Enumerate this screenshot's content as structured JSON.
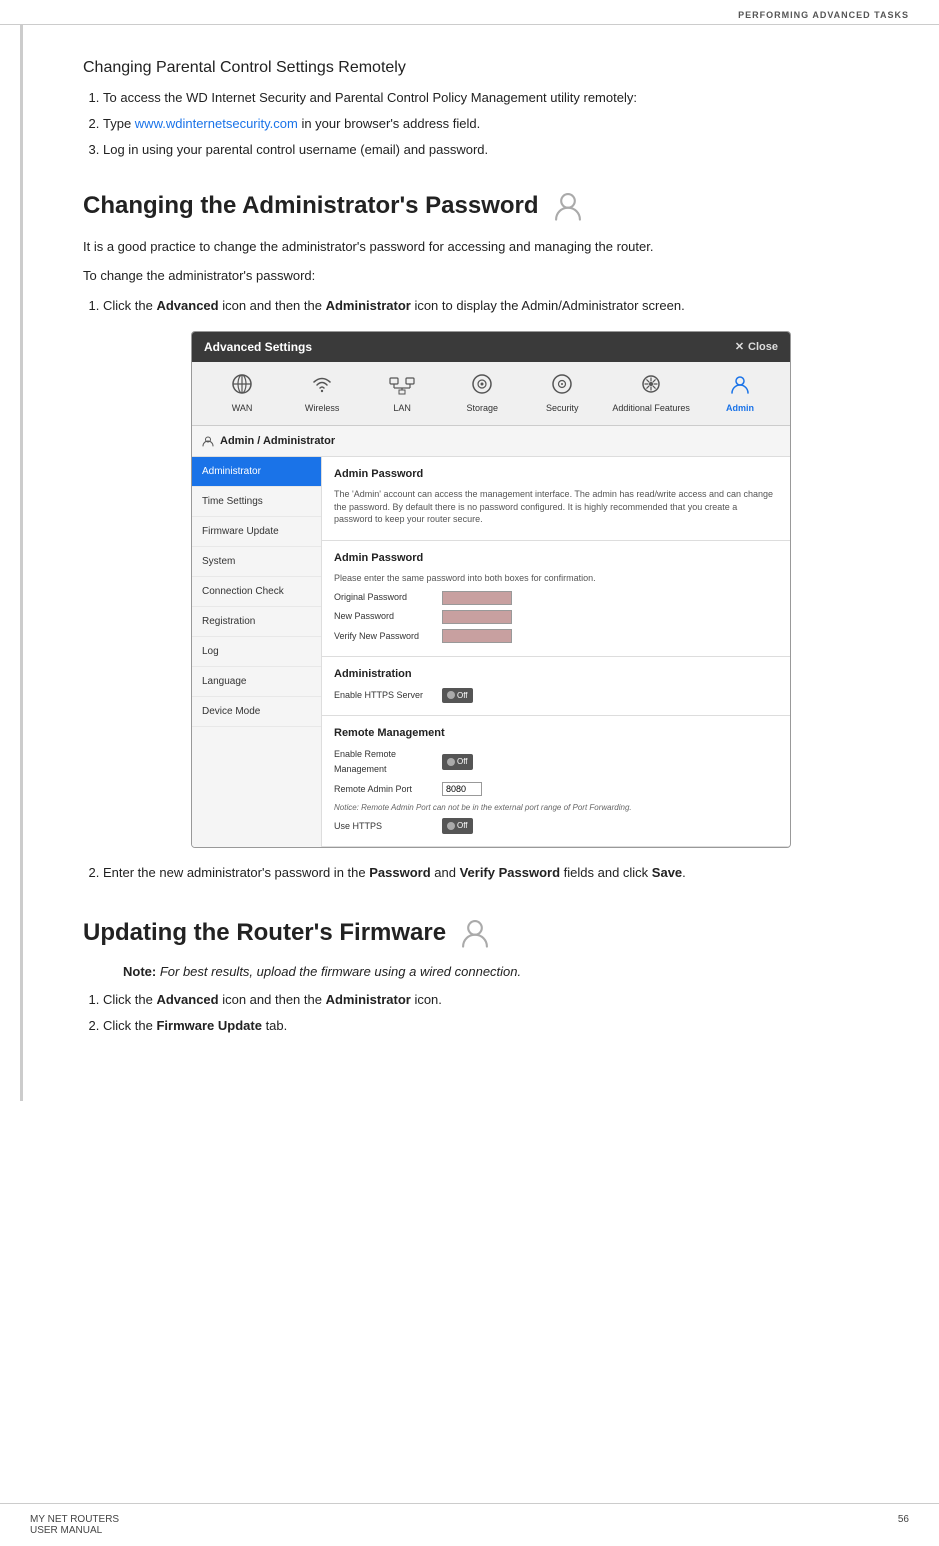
{
  "header": {
    "title": "PERFORMING ADVANCED TASKS"
  },
  "section1": {
    "title": "Changing Parental Control Settings Remotely",
    "steps": [
      "To access the WD Internet Security and Parental Control Policy Management utility remotely:",
      "Type www.wdinternetsecurity.com in your browser's address field.",
      "Log in using your parental control username (email) and password."
    ],
    "link_text": "www.wdinternetsecurity.com"
  },
  "section2": {
    "title": "Changing the Administrator's Password",
    "intro1": "It is a good practice to change the administrator's password for accessing and managing the router.",
    "intro2": "To change the administrator's password:",
    "steps": [
      {
        "text_before": "Click the ",
        "bold1": "Advanced",
        "text_mid": " icon and then the ",
        "bold2": "Administrator",
        "text_after": " icon to display the Admin/Administrator screen."
      },
      {
        "text_before": "Enter the new administrator's password in the ",
        "bold1": "Password",
        "text_mid": " and ",
        "bold2": "Verify Password",
        "text_after": " fields and click ",
        "bold3": "Save",
        "text_end": "."
      }
    ],
    "panel": {
      "titlebar": "Advanced Settings",
      "close_label": "Close",
      "nav_items": [
        {
          "label": "WAN",
          "icon": "globe"
        },
        {
          "label": "Wireless",
          "icon": "wifi"
        },
        {
          "label": "LAN",
          "icon": "lan"
        },
        {
          "label": "Storage",
          "icon": "storage"
        },
        {
          "label": "Security",
          "icon": "security"
        },
        {
          "label": "Additional Features",
          "icon": "features"
        },
        {
          "label": "Admin",
          "icon": "admin",
          "active": true
        }
      ],
      "section_header": "Admin / Administrator",
      "sidebar_items": [
        {
          "label": "Administrator",
          "active": true
        },
        {
          "label": "Time Settings"
        },
        {
          "label": "Firmware Update"
        },
        {
          "label": "System"
        },
        {
          "label": "Connection Check"
        },
        {
          "label": "Registration"
        },
        {
          "label": "Log"
        },
        {
          "label": "Language"
        },
        {
          "label": "Device Mode"
        }
      ],
      "form_section1_title": "Admin Password",
      "form_section1_desc": "The 'Admin' account can access the management interface. The admin has read/write access and can change the password. By default there is no password configured. It is highly recommended that you create a password to keep your router secure.",
      "form_section2_title": "Admin Password",
      "form_section2_desc": "Please enter the same password into both boxes for confirmation.",
      "form_fields": [
        {
          "label": "Original Password"
        },
        {
          "label": "New Password"
        },
        {
          "label": "Verify New Password"
        }
      ],
      "admin_section_title": "Administration",
      "https_label": "Enable HTTPS Server",
      "https_value": "Off",
      "remote_section_title": "Remote Management",
      "remote_mgmt_label": "Enable Remote Management",
      "remote_mgmt_value": "Off",
      "remote_port_label": "Remote Admin Port",
      "remote_port_value": "8080",
      "notice": "Notice: Remote Admin Port can not be in the external port range of Port Forwarding.",
      "use_https_label": "Use HTTPS",
      "use_https_value": "Off"
    }
  },
  "section3": {
    "title": "Updating the Router's Firmware",
    "note_label": "Note:",
    "note_text": "For best results, upload the firmware using a wired connection.",
    "steps": [
      {
        "text_before": "Click the ",
        "bold1": "Advanced",
        "text_mid": " icon and then the ",
        "bold2": "Administrator",
        "text_after": " icon."
      },
      {
        "text_before": "Click the ",
        "bold1": "Firmware Update",
        "text_after": " tab."
      }
    ]
  },
  "footer": {
    "left1": "MY NET ROUTERS",
    "left2": "USER MANUAL",
    "page": "56"
  }
}
